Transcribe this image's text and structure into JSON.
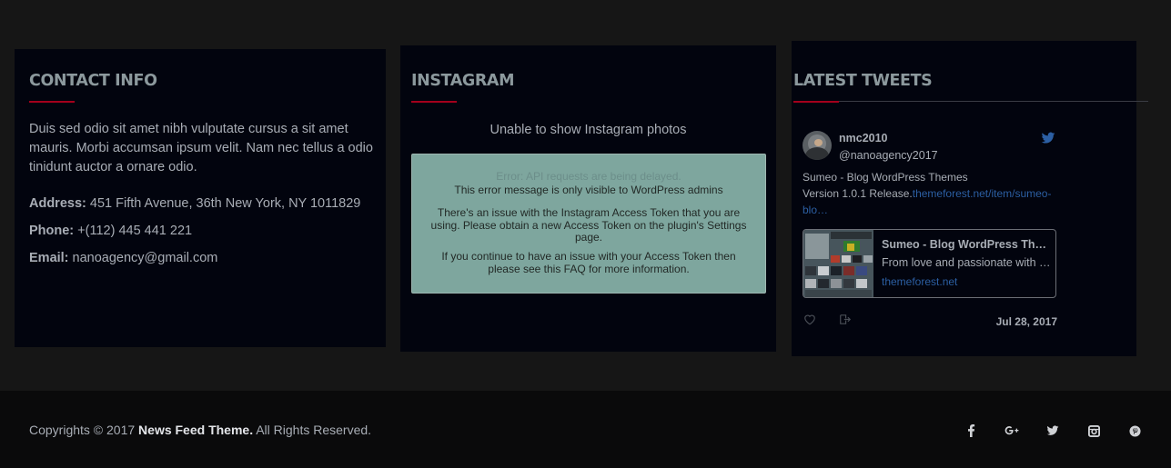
{
  "contact": {
    "title": "CONTACT INFO",
    "description": "Duis sed odio sit amet nibh vulputate cursus a sit amet mauris. Morbi accumsan ipsum velit. Nam nec tellus a odio tinidunt auctor a ornare odio.",
    "address_label": "Address:",
    "address_value": " 451 Fifth Avenue, 36th New York, NY 1011829",
    "phone_label": "Phone:",
    "phone_value": " +(112) 445 441 221",
    "email_label": "Email:",
    "email_value": " nanoagency@gmail.com"
  },
  "instagram": {
    "title": "INSTAGRAM",
    "unable_message": "Unable to show Instagram photos",
    "error_heading": "Error: API requests are being delayed.",
    "error_visibility": "This error message is only visible to WordPress admins",
    "error_body": "There's an issue with the Instagram Access Token that you are using. Please obtain a new Access Token on the plugin's Settings page.",
    "error_body2": "If you continue to have an issue with your Access Token then please see this FAQ for more information."
  },
  "tweets": {
    "title": "LATEST TWEETS",
    "user_name": "nmc2010",
    "user_handle": "@nanoagency2017",
    "tweet_text": "Sumeo - Blog WordPress Themes",
    "tweet_line2_prefix": " Version 1.0.1 Release.",
    "tweet_link": "themeforest.net/item/sumeo-blo…",
    "card_title": "Sumeo - Blog WordPress The…",
    "card_desc": "From love and passionate with …",
    "card_url": "themeforest.net",
    "date": "Jul 28, 2017",
    "icons": {
      "bird": "twitter-bird-icon",
      "like": "heart-icon",
      "reply": "reply-icon"
    }
  },
  "footer": {
    "copyright_prefix": "Copyrights © 2017 ",
    "brand": "News Feed Theme.",
    "copyright_suffix": " All Rights Reserved.",
    "social": [
      {
        "name": "facebook-icon",
        "glyph": "f"
      },
      {
        "name": "google-plus-icon",
        "glyph": "g+"
      },
      {
        "name": "twitter-icon",
        "glyph": ""
      },
      {
        "name": "instagram-icon",
        "glyph": ""
      },
      {
        "name": "pinterest-icon",
        "glyph": ""
      }
    ]
  },
  "colors": {
    "background": "#161616",
    "widget": "#02040e",
    "accent": "#a3001c",
    "title": "#8c999d",
    "link": "#2c5fa3",
    "error_box": "#7ea69e",
    "footer": "#0a0a0b"
  }
}
